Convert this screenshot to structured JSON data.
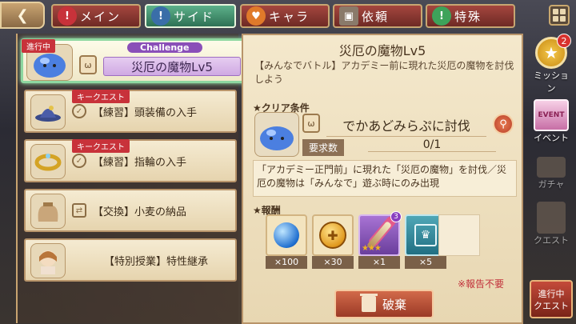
{
  "tabs": [
    {
      "label": "メイン",
      "icon": "exclaim-icon"
    },
    {
      "label": "サイド",
      "icon": "exclaim-icon"
    },
    {
      "label": "キャラ",
      "icon": "heart-icon"
    },
    {
      "label": "依頼",
      "icon": "portrait-icon"
    },
    {
      "label": "特殊",
      "icon": "exclaim-icon"
    }
  ],
  "quests": [
    {
      "status": "進行中",
      "badge": "Challenge",
      "title": "災厄の魔物Lv5"
    },
    {
      "badge": "キークエスト",
      "title": "【練習】頭装備の入手"
    },
    {
      "badge": "キークエスト",
      "title": "【練習】指輪の入手"
    },
    {
      "title": "【交換】小麦の納品"
    },
    {
      "title": "【特別授業】特性継承"
    }
  ],
  "detail": {
    "title": "災厄の魔物Lv5",
    "description": "【みんなでバトル】アカデミー前に現れた災厄の魔物を討伐しよう",
    "clear_label": "クリア条件",
    "condition": "でかあどみらぷに討伐",
    "req_label": "要求数",
    "req_count": "0/1",
    "note": "「アカデミー正門前」に現れた「災厄の魔物」を討伐／災厄の魔物は「みんなで」遊ぶ時にのみ出現",
    "reward_label": "報酬",
    "rewards": [
      "×100",
      "×30",
      "×1",
      "×5"
    ],
    "no_report": "※報告不要",
    "discard_label": "破棄"
  },
  "side": {
    "mission_label": "ミッション",
    "mission_badge": "2",
    "event_label": "イベント",
    "event_card": "EVENT",
    "gacha_label": "ガチャ",
    "quest_label": "クエスト",
    "ongoing_line1": "進行中",
    "ongoing_line2": "クエスト"
  }
}
